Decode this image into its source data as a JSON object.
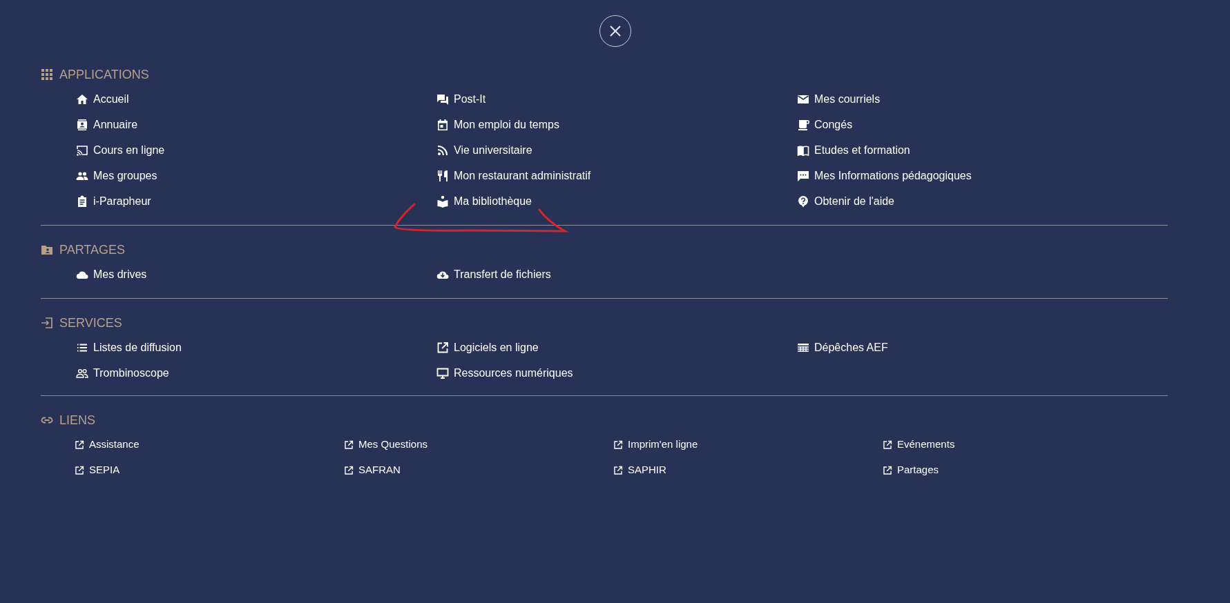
{
  "sections": [
    {
      "title": "APPLICATIONS",
      "items": [
        {
          "label": "Accueil"
        },
        {
          "label": "Post-It"
        },
        {
          "label": "Mes courriels"
        },
        {
          "label": "Annuaire"
        },
        {
          "label": "Mon emploi du temps"
        },
        {
          "label": "Congés"
        },
        {
          "label": "Cours en ligne"
        },
        {
          "label": "Vie universitaire"
        },
        {
          "label": "Etudes et formation"
        },
        {
          "label": "Mes groupes"
        },
        {
          "label": "Mon restaurant administratif"
        },
        {
          "label": "Mes Informations pédagogiques"
        },
        {
          "label": "i-Parapheur"
        },
        {
          "label": "Ma bibliothèque"
        },
        {
          "label": "Obtenir de l'aide"
        }
      ]
    },
    {
      "title": "PARTAGES",
      "items": [
        {
          "label": "Mes drives"
        },
        {
          "label": "Transfert de fichiers"
        }
      ]
    },
    {
      "title": "SERVICES",
      "items": [
        {
          "label": "Listes de diffusion"
        },
        {
          "label": "Logiciels en ligne"
        },
        {
          "label": "Dépêches AEF"
        },
        {
          "label": "Trombinoscope"
        },
        {
          "label": "Ressources numériques"
        }
      ]
    },
    {
      "title": "LIENS",
      "items": [
        {
          "label": "Assistance"
        },
        {
          "label": "Mes Questions"
        },
        {
          "label": "Imprim'en ligne"
        },
        {
          "label": "Evénements"
        },
        {
          "label": "SEPIA"
        },
        {
          "label": "SAFRAN"
        },
        {
          "label": "SAPHIR"
        },
        {
          "label": "Partages"
        }
      ]
    }
  ]
}
